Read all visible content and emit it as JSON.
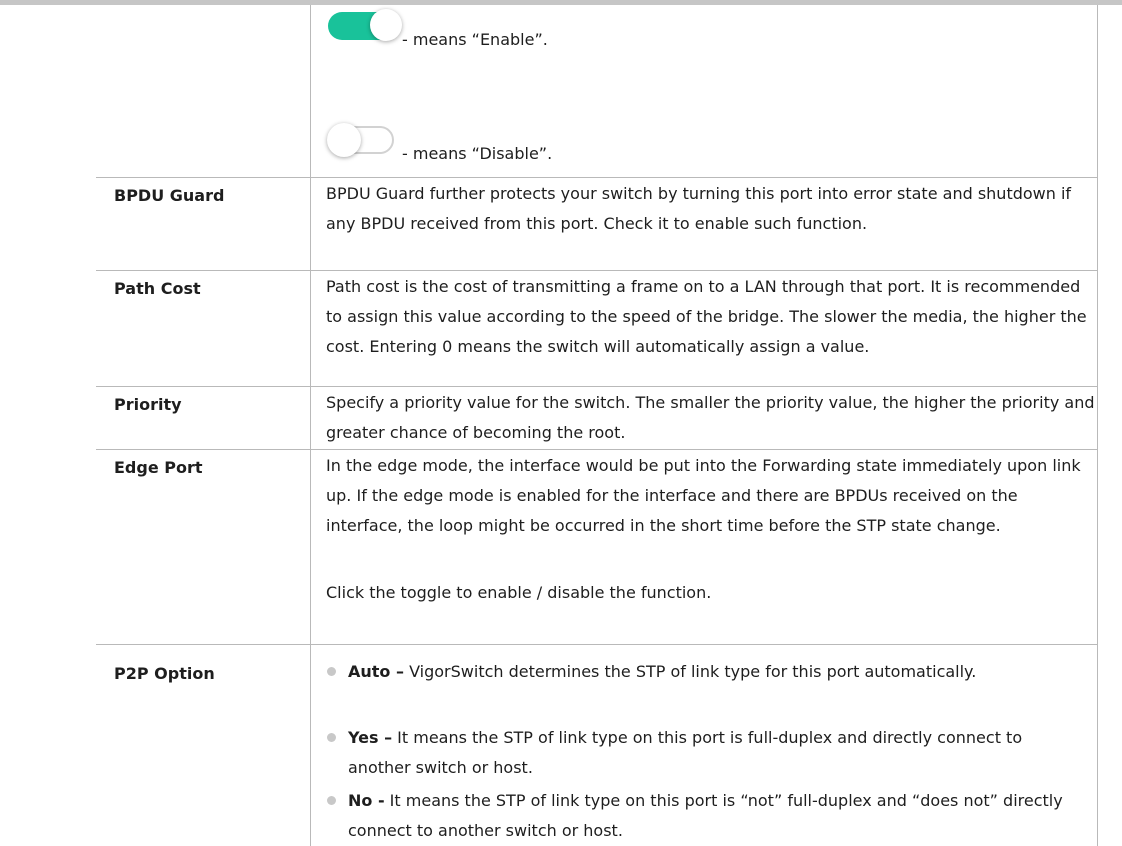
{
  "toggle_legend": {
    "enable_caption": "- means “Enable”.",
    "disable_caption": "- means “Disable”.",
    "enable_color": "#19c29a"
  },
  "rows": {
    "bpdu_guard": {
      "label": "BPDU Guard",
      "desc": "BPDU Guard further protects your switch by turning this port into error state and shutdown if any BPDU received from this port. Check it to enable such function."
    },
    "path_cost": {
      "label": "Path Cost",
      "desc": "Path cost is the cost of transmitting a frame on to a LAN through that port. It is recommended to assign this value according to the speed of the bridge. The slower the media, the higher the cost. Entering 0 means the switch will automatically assign a value."
    },
    "priority": {
      "label": "Priority",
      "desc": "Specify a priority value for the switch. The smaller the priority value, the higher the priority and greater chance of becoming the root."
    },
    "edge_port": {
      "label": "Edge Port",
      "desc": "In the edge mode, the interface would be put into the Forwarding state immediately upon link up. If the edge mode is enabled for the interface and there are BPDUs received on the interface, the loop might be occurred in the short time before the STP state change.",
      "note": "Click the toggle to enable / disable the function."
    },
    "p2p_option": {
      "label": "P2P Option",
      "items": [
        {
          "term": "Auto –",
          "text": " VigorSwitch determines the STP of link type for this port automatically."
        },
        {
          "term": "Yes –",
          "text": " It means the STP of link type on this port is full-duplex and directly connect to another switch or host."
        },
        {
          "term": "No -",
          "text": " It means the STP of link type on this port is “not” full-duplex and “does not” directly connect to another switch or host."
        }
      ]
    }
  }
}
